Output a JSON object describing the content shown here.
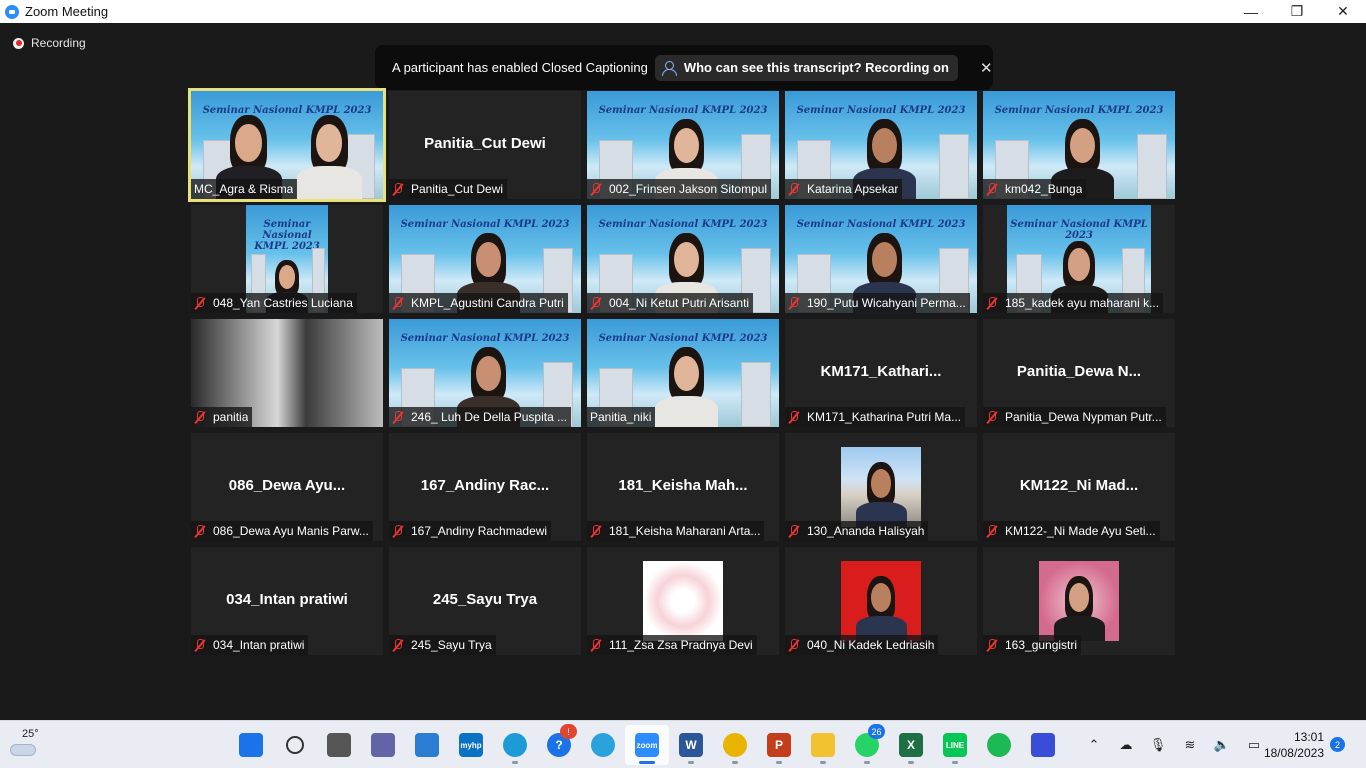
{
  "window": {
    "title": "Zoom Meeting",
    "minimize": "—",
    "maximize": "❐",
    "close": "✕"
  },
  "meeting": {
    "recording_label": "Recording",
    "caption_banner": {
      "message": "A participant has enabled Closed Captioning",
      "link": "Who can see this transcript? Recording on",
      "close": "✕"
    }
  },
  "video_banner_text": "Seminar Nasional KMPL 2023",
  "tiles": [
    {
      "name": "MC_Agra & Risma",
      "type": "video",
      "active": true,
      "muted": false,
      "people": 2
    },
    {
      "name": "Panitia_Cut Dewi",
      "display": "Panitia_Cut Dewi",
      "type": "avatar",
      "muted": true
    },
    {
      "name": "002_Frinsen Jakson Sitompul",
      "type": "video",
      "muted": true,
      "people": 1
    },
    {
      "name": "Katarina Apsekar",
      "type": "video",
      "muted": true,
      "people": 1
    },
    {
      "name": "km042_Bunga",
      "type": "video",
      "muted": true,
      "people": 1
    },
    {
      "name": "048_Yan Castries Luciana",
      "type": "video-narrow",
      "muted": true,
      "people": 1
    },
    {
      "name": "KMPL_Agustini Candra Putri",
      "type": "video",
      "muted": true,
      "people": 1
    },
    {
      "name": "004_Ni Ketut Putri Arisanti",
      "type": "video",
      "muted": true,
      "people": 1
    },
    {
      "name": "190_Putu Wicahyani Perma...",
      "type": "video",
      "muted": true,
      "people": 1
    },
    {
      "name": "185_kadek ayu maharani k...",
      "type": "video-narrow",
      "muted": true,
      "people": 1
    },
    {
      "name": "panitia",
      "type": "dark-video",
      "muted": true
    },
    {
      "name": "246_ Luh De Della Puspita ...",
      "type": "video",
      "muted": true,
      "people": 1
    },
    {
      "name": "Panitia_niki",
      "type": "video",
      "muted": false,
      "people": 1
    },
    {
      "name": "KM171_Katharina Putri Ma...",
      "display": "KM171_Kathari...",
      "type": "avatar",
      "muted": true
    },
    {
      "name": "Panitia_Dewa Nypman Putr...",
      "display": "Panitia_Dewa  N...",
      "type": "avatar",
      "muted": true
    },
    {
      "name": "086_Dewa Ayu Manis Parw...",
      "display": "086_Dewa  Ayu...",
      "type": "avatar",
      "muted": true
    },
    {
      "name": "167_Andiny Rachmadewi",
      "display": "167_Andiny  Rac...",
      "type": "avatar",
      "muted": true
    },
    {
      "name": "181_Keisha Maharani Arta...",
      "display": "181_Keisha  Mah...",
      "type": "avatar",
      "muted": true
    },
    {
      "name": "130_Ananda Halisyah",
      "type": "photo-street",
      "muted": true
    },
    {
      "name": "KM122-_Ni Made Ayu Seti...",
      "display": "KM122_Ni  Mad...",
      "type": "avatar",
      "muted": true
    },
    {
      "name": "034_Intan pratiwi",
      "display": "034_Intan pratiwi",
      "type": "avatar",
      "muted": true
    },
    {
      "name": "245_Sayu Trya",
      "display": "245_Sayu Trya",
      "type": "avatar",
      "muted": true
    },
    {
      "name": "111_Zsa Zsa Pradnya Devi",
      "type": "photo-drawing",
      "muted": true
    },
    {
      "name": "040_Ni Kadek Ledriasih",
      "type": "photo-red",
      "muted": true
    },
    {
      "name": "163_gungistri",
      "type": "photo-pink",
      "muted": true
    }
  ],
  "taskbar": {
    "weather_temp": "25°",
    "apps": [
      {
        "name": "start",
        "color": "#1a73e8",
        "glyph": ""
      },
      {
        "name": "search",
        "color": "transparent",
        "glyph": ""
      },
      {
        "name": "task-view",
        "color": "#555",
        "glyph": ""
      },
      {
        "name": "teams",
        "color": "#6264a7",
        "glyph": ""
      },
      {
        "name": "store",
        "color": "#2b7cd3",
        "glyph": ""
      },
      {
        "name": "myhp",
        "color": "#0a72c5",
        "glyph": "myhp"
      },
      {
        "name": "edge",
        "color": "#1d9bd8",
        "glyph": "",
        "running": true
      },
      {
        "name": "help",
        "color": "#1a73e8",
        "glyph": "?",
        "badge": "!",
        "badge_color": "#e0462f"
      },
      {
        "name": "telegram",
        "color": "#2aa3dc",
        "glyph": ""
      },
      {
        "name": "zoom",
        "color": "#2d8cff",
        "glyph": "zoom",
        "active": true
      },
      {
        "name": "word",
        "color": "#2b579a",
        "glyph": "W",
        "running": true
      },
      {
        "name": "chrome",
        "color": "#e8b400",
        "glyph": "",
        "running": true
      },
      {
        "name": "powerpoint",
        "color": "#c43e1c",
        "glyph": "P",
        "running": true
      },
      {
        "name": "file-explorer",
        "color": "#f2c230",
        "glyph": "",
        "running": true
      },
      {
        "name": "whatsapp",
        "color": "#25d366",
        "glyph": "",
        "badge": "26",
        "badge_color": "#1a73e8",
        "running": true
      },
      {
        "name": "excel",
        "color": "#1d7044",
        "glyph": "X",
        "running": true
      },
      {
        "name": "line",
        "color": "#06c755",
        "glyph": "LINE",
        "running": true
      },
      {
        "name": "spotify",
        "color": "#1db954",
        "glyph": ""
      },
      {
        "name": "wondershare",
        "color": "#3a4dd8",
        "glyph": ""
      }
    ],
    "time": "13:01",
    "date": "18/08/2023",
    "notifications": "2"
  }
}
